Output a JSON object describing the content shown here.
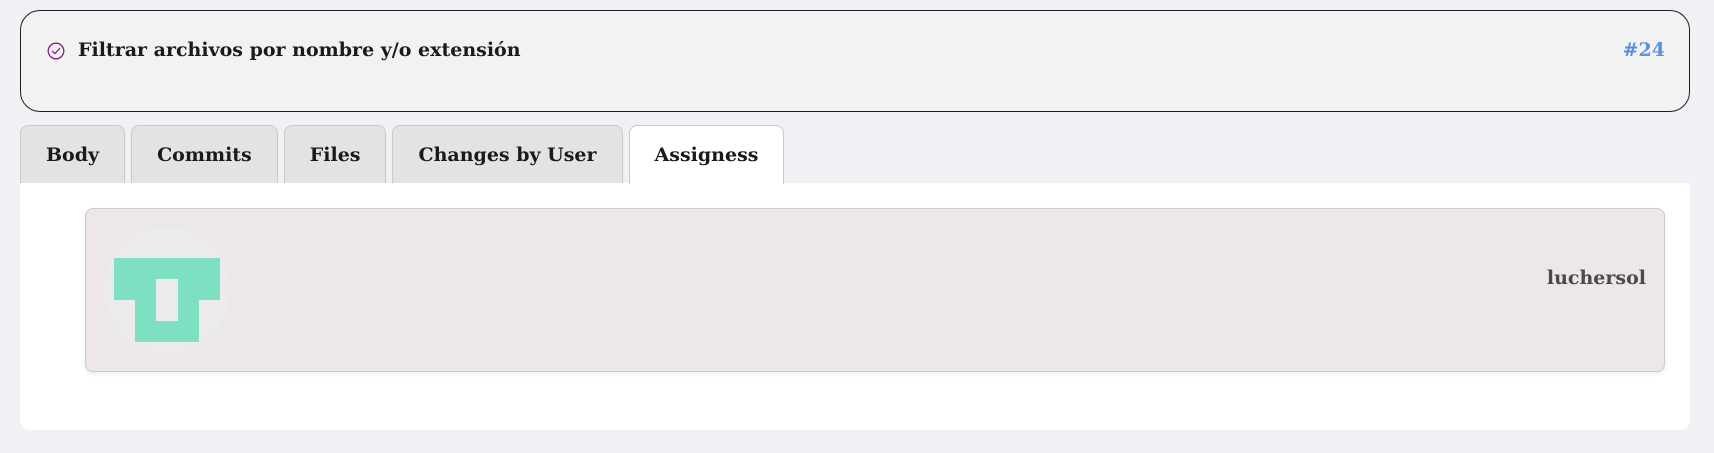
{
  "issue": {
    "title": "Filtrar archivos por nombre y/o extensión",
    "number": "#24",
    "status_icon": "check-circle-icon",
    "status_color": "#8b1a8b",
    "number_color": "#5b8fe0"
  },
  "tabs": [
    {
      "label": "Body",
      "active": false
    },
    {
      "label": "Commits",
      "active": false
    },
    {
      "label": "Files",
      "active": false
    },
    {
      "label": "Changes by User",
      "active": false
    },
    {
      "label": "Assigness",
      "active": true
    }
  ],
  "assignees": [
    {
      "login": "luchersol",
      "avatar": "identicon",
      "avatar_color": "#7ee0c2"
    }
  ]
}
